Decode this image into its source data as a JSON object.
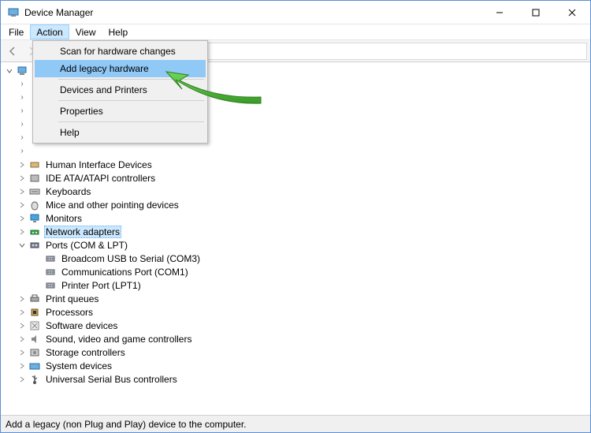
{
  "window": {
    "title": "Device Manager"
  },
  "menubar": {
    "items": [
      "File",
      "Action",
      "View",
      "Help"
    ],
    "active_index": 1
  },
  "dropdown": {
    "items": [
      {
        "label": "Scan for hardware changes",
        "highlight": false
      },
      {
        "label": "Add legacy hardware",
        "highlight": true
      }
    ],
    "items2": [
      {
        "label": "Devices and Printers"
      }
    ],
    "items3": [
      {
        "label": "Properties"
      }
    ],
    "items4": [
      {
        "label": "Help"
      }
    ]
  },
  "tree": {
    "root_expander": "v",
    "top_hidden_count": 4,
    "nodes": [
      {
        "label": "Human Interface Devices",
        "icon": "hid-icon",
        "expanded": false,
        "depth": 1
      },
      {
        "label": "IDE ATA/ATAPI controllers",
        "icon": "ide-icon",
        "expanded": false,
        "depth": 1
      },
      {
        "label": "Keyboards",
        "icon": "keyboard-icon",
        "expanded": false,
        "depth": 1
      },
      {
        "label": "Mice and other pointing devices",
        "icon": "mouse-icon",
        "expanded": false,
        "depth": 1
      },
      {
        "label": "Monitors",
        "icon": "monitor-icon",
        "expanded": false,
        "depth": 1
      },
      {
        "label": "Network adapters",
        "icon": "network-icon",
        "expanded": false,
        "depth": 1,
        "selected": true
      },
      {
        "label": "Ports (COM & LPT)",
        "icon": "port-icon",
        "expanded": true,
        "depth": 1
      },
      {
        "label": "Broadcom USB to Serial (COM3)",
        "icon": "serial-icon",
        "expanded": null,
        "depth": 2
      },
      {
        "label": "Communications Port (COM1)",
        "icon": "serial-icon",
        "expanded": null,
        "depth": 2
      },
      {
        "label": "Printer Port (LPT1)",
        "icon": "serial-icon",
        "expanded": null,
        "depth": 2
      },
      {
        "label": "Print queues",
        "icon": "printer-icon",
        "expanded": false,
        "depth": 1
      },
      {
        "label": "Processors",
        "icon": "cpu-icon",
        "expanded": false,
        "depth": 1
      },
      {
        "label": "Software devices",
        "icon": "software-icon",
        "expanded": false,
        "depth": 1
      },
      {
        "label": "Sound, video and game controllers",
        "icon": "sound-icon",
        "expanded": false,
        "depth": 1
      },
      {
        "label": "Storage controllers",
        "icon": "storage-icon",
        "expanded": false,
        "depth": 1
      },
      {
        "label": "System devices",
        "icon": "system-icon",
        "expanded": false,
        "depth": 1
      },
      {
        "label": "Universal Serial Bus controllers",
        "icon": "usb-icon",
        "expanded": false,
        "depth": 1
      }
    ]
  },
  "statusbar": {
    "text": "Add a legacy (non Plug and Play) device to the computer."
  },
  "colors": {
    "highlight": "#90c8f6",
    "selection": "#cce8ff",
    "arrow": "#4caf3a"
  }
}
